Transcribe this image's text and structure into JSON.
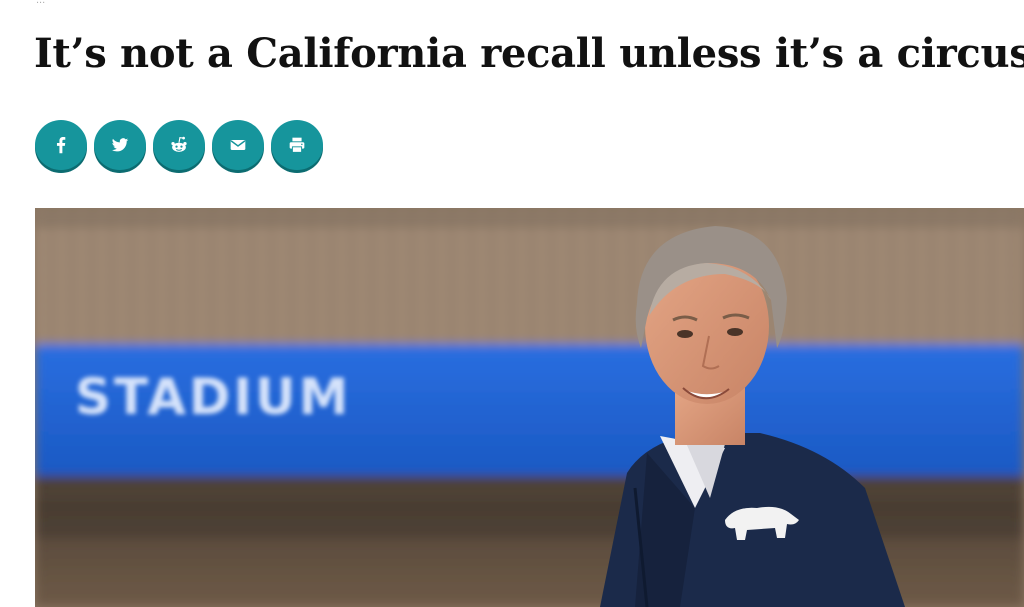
{
  "article": {
    "byline_fragment": "...",
    "headline": "It’s not a California recall unless it’s a circus"
  },
  "share": {
    "buttons": [
      {
        "name": "facebook",
        "icon": "facebook-icon"
      },
      {
        "name": "twitter",
        "icon": "twitter-icon"
      },
      {
        "name": "reddit",
        "icon": "reddit-icon"
      },
      {
        "name": "email",
        "icon": "email-icon"
      },
      {
        "name": "print",
        "icon": "print-icon"
      }
    ],
    "color": "#16959c"
  },
  "hero_image": {
    "sign_text": "STADIUM",
    "colors": {
      "banner": "#1e5fd6",
      "jacket": "#1b2a4a",
      "stands": "#9c8470"
    }
  }
}
